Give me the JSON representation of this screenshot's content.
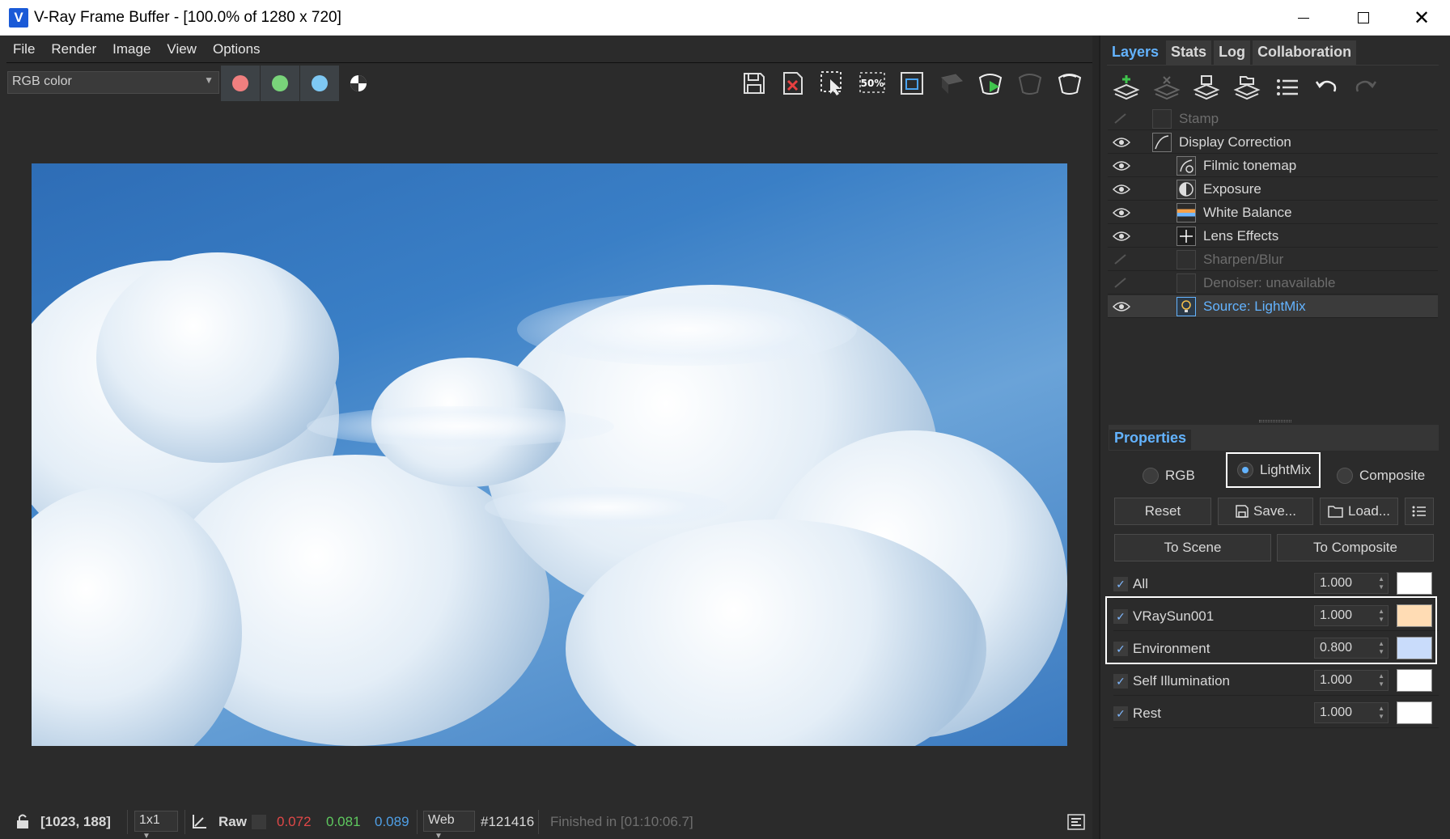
{
  "window": {
    "title": "V-Ray Frame Buffer - [100.0% of 1280 x 720]",
    "app_icon": "V"
  },
  "menu": [
    "File",
    "Render",
    "Image",
    "View",
    "Options"
  ],
  "toolbar": {
    "channel": "RGB color",
    "channel_buttons": [
      {
        "name": "red-channel",
        "color": "#f07f7f"
      },
      {
        "name": "green-channel",
        "color": "#79d47a"
      },
      {
        "name": "blue-channel",
        "color": "#7ec8f3"
      }
    ],
    "icons": [
      "save-icon",
      "clear-image-icon",
      "track-mouse-icon",
      "zoom-50-icon",
      "region-render-icon",
      "stop-render-icon",
      "render-icon",
      "render-last-icon",
      "interactive-render-icon"
    ]
  },
  "statusbar": {
    "coords": "[1023, 188]",
    "sample_size": "1x1",
    "raw_label": "Raw",
    "r_value": "0.072",
    "g_value": "0.081",
    "b_value": "0.089",
    "color_space": "Web",
    "hex": "#121416",
    "status": "Finished in [01:10:06.7]",
    "colors": {
      "r": "#e04848",
      "g": "#5ec85e",
      "b": "#4f9fe6",
      "muted": "#6f6f6f"
    }
  },
  "right_panel": {
    "tabs": [
      {
        "label": "Layers",
        "active": true
      },
      {
        "label": "Stats",
        "active": false
      },
      {
        "label": "Log",
        "active": false
      },
      {
        "label": "Collaboration",
        "active": false
      }
    ],
    "layer_tools": [
      "create-layer-icon",
      "delete-layer-icon",
      "save-layer-tree-icon",
      "load-layer-tree-icon",
      "layer-list-icon",
      "undo-icon",
      "redo-icon"
    ],
    "layers": [
      {
        "label": "Stamp",
        "visible": false,
        "indent": 0,
        "selected": false
      },
      {
        "label": "Display Correction",
        "visible": true,
        "indent": 0,
        "selected": false
      },
      {
        "label": "Filmic tonemap",
        "visible": true,
        "indent": 1,
        "selected": false
      },
      {
        "label": "Exposure",
        "visible": true,
        "indent": 1,
        "selected": false
      },
      {
        "label": "White Balance",
        "visible": true,
        "indent": 1,
        "selected": false
      },
      {
        "label": "Lens Effects",
        "visible": true,
        "indent": 1,
        "selected": false
      },
      {
        "label": "Sharpen/Blur",
        "visible": false,
        "indent": 1,
        "selected": false
      },
      {
        "label": "Denoiser: unavailable",
        "visible": false,
        "indent": 1,
        "selected": false
      },
      {
        "label": "Source: LightMix",
        "visible": true,
        "indent": 1,
        "selected": true
      }
    ],
    "properties": {
      "header": "Properties",
      "modes": [
        {
          "label": "RGB",
          "checked": false
        },
        {
          "label": "LightMix",
          "checked": true
        },
        {
          "label": "Composite",
          "checked": false
        }
      ],
      "buttons": {
        "reset": "Reset",
        "save": "Save...",
        "load": "Load...",
        "to_scene": "To Scene",
        "to_composite": "To Composite"
      },
      "lightmix": [
        {
          "label": "All",
          "value": "1.000",
          "color": "#ffffff",
          "checked": true
        },
        {
          "label": "VRaySun001",
          "value": "1.000",
          "color": "#ffdcb4",
          "checked": true
        },
        {
          "label": "Environment",
          "value": "0.800",
          "color": "#c9dcfb",
          "checked": true
        },
        {
          "label": "Self Illumination",
          "value": "1.000",
          "color": "#ffffff",
          "checked": true
        },
        {
          "label": "Rest",
          "value": "1.000",
          "color": "#ffffff",
          "checked": true
        }
      ]
    }
  },
  "accent_color": "#63b3ff"
}
